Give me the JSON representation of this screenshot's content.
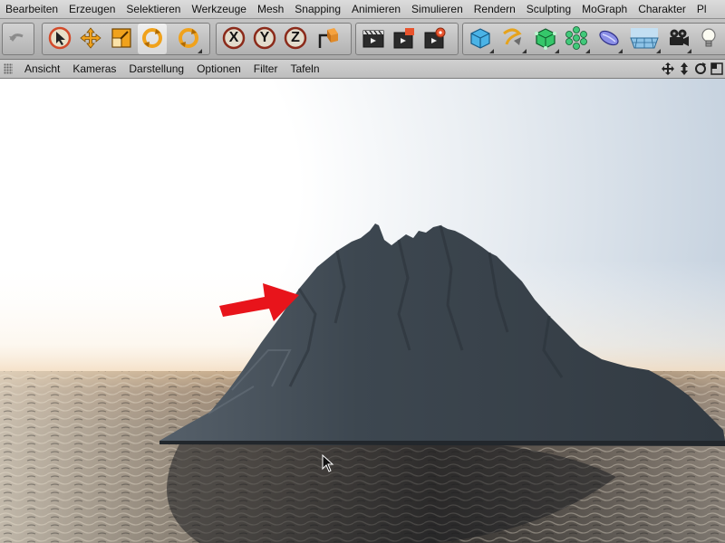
{
  "menu": {
    "items": [
      "Bearbeiten",
      "Erzeugen",
      "Selektieren",
      "Werkzeuge",
      "Mesh",
      "Snapping",
      "Animieren",
      "Simulieren",
      "Rendern",
      "Sculpting",
      "MoGraph",
      "Charakter",
      "Pl"
    ]
  },
  "toolbar": {
    "groups": [
      {
        "name": "history",
        "icons": [
          "undo-icon"
        ]
      },
      {
        "name": "transform-tools",
        "icons": [
          "select-arrow-icon",
          "move-icon",
          "scale-icon",
          "rotate-icon",
          "rotate-alt-icon"
        ]
      },
      {
        "name": "axis-lock",
        "icons": [
          "x-axis-icon",
          "y-axis-icon",
          "z-axis-icon",
          "coordinate-system-icon"
        ]
      },
      {
        "name": "render",
        "icons": [
          "render-view-icon",
          "render-region-icon",
          "render-settings-icon"
        ]
      },
      {
        "name": "objects",
        "icons": [
          "cube-icon",
          "spline-pen-icon",
          "subdivision-icon",
          "cloner-icon",
          "deformer-icon",
          "floor-icon",
          "camera-icon",
          "light-icon"
        ]
      }
    ],
    "axis_labels": [
      "X",
      "Y",
      "Z"
    ]
  },
  "viewbar": {
    "items": [
      "Ansicht",
      "Kameras",
      "Darstellung",
      "Optionen",
      "Filter",
      "Tafeln"
    ],
    "nav_icons": [
      "pan-icon",
      "zoom-icon",
      "orbit-icon",
      "maximize-view-icon"
    ]
  },
  "colors": {
    "sky_top": "#cfd9e3",
    "horizon_glow": "#fff7ec",
    "water": "#3a3836",
    "island": "#3b444d",
    "arrow": "#e8141b"
  }
}
